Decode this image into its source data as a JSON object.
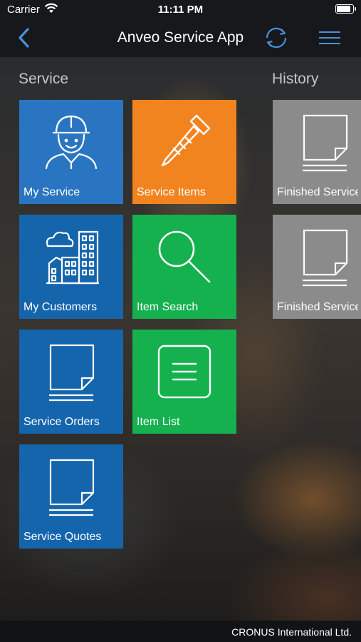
{
  "status_bar": {
    "carrier": "Carrier",
    "time": "11:11 PM",
    "battery_level": 0.9
  },
  "nav": {
    "title": "Anveo Service App",
    "back_icon": "chevron-left-icon",
    "sync_icon": "sync-icon",
    "menu_icon": "hamburger-menu-icon",
    "accent": "#4a8fd8"
  },
  "sections": {
    "service": "Service",
    "history": "History"
  },
  "tiles": {
    "my_service": {
      "label": "My Service",
      "icon": "worker-icon",
      "color": "#2a75c1"
    },
    "service_items": {
      "label": "Service Items",
      "icon": "screw-icon",
      "color": "#f28420"
    },
    "my_customers": {
      "label": "My Customers",
      "icon": "buildings-icon",
      "color": "#1565ad"
    },
    "item_search": {
      "label": "Item Search",
      "icon": "magnifier-icon",
      "color": "#14b14e"
    },
    "service_orders": {
      "label": "Service Orders",
      "icon": "document-icon",
      "color": "#1565ad"
    },
    "item_list": {
      "label": "Item List",
      "icon": "list-icon",
      "color": "#14b14e"
    },
    "service_quotes": {
      "label": "Service Quotes",
      "icon": "document-icon",
      "color": "#1565ad"
    },
    "finished_service_orders": {
      "label": "Finished Service\nOrders",
      "icon": "document-icon",
      "color": "#8b8b8b"
    },
    "finished_service_quotes": {
      "label": "Finished Service\nQuotes",
      "icon": "document-icon",
      "color": "#8b8b8b"
    }
  },
  "footer": {
    "company": "CRONUS International Ltd."
  }
}
